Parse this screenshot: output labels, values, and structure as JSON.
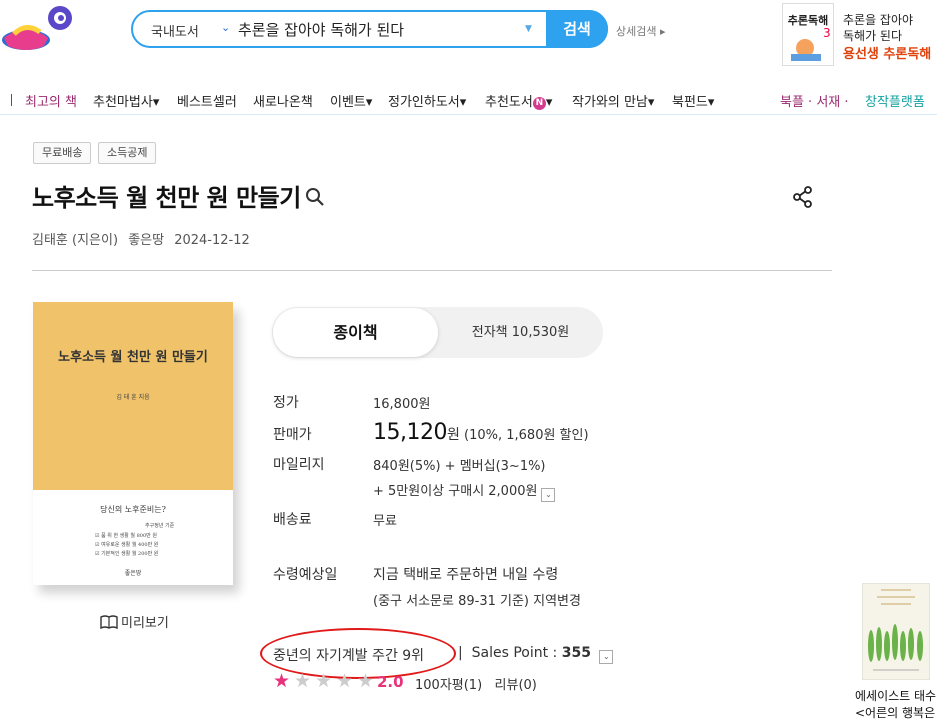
{
  "header": {
    "search": {
      "category": "국내도서",
      "query": "추론을 잡아야 독해가 된다",
      "button": "검색"
    },
    "advanced_search": "상세검색",
    "ad": {
      "cover_text": "추론독해",
      "line1": "추론을 잡아야",
      "line2": "독해가 된다",
      "line3": "용선생 추론독해"
    }
  },
  "nav": {
    "items": [
      "최고의 책",
      "추천마법사",
      "베스트셀러",
      "새로나온책",
      "이벤트",
      "정가인하도서",
      "추천도서",
      "작가와의 만남",
      "북펀드"
    ],
    "new_badge": "N",
    "right_links": [
      "북플 · 서재 ·",
      "창작플랫폼"
    ]
  },
  "product": {
    "tags": [
      "무료배송",
      "소득공제"
    ],
    "title": "노후소득 월 천만 원 만들기",
    "author": "김태훈 (지은이)",
    "publisher": "좋은땅",
    "date": "2024-12-12",
    "cover": {
      "title": "노후소득 월 천만 원 만들기",
      "author": "김 태 훈 지음",
      "subtitle": "당신의 노후준비는?",
      "tier_header": "추구정년 기준",
      "lines": [
        "☑ 품 위 한 생활 월 800만 원",
        "☑ 여유로운 생활 월 400만 원",
        "☑ 기본적인 생활 월 200만 원"
      ],
      "publisher": "좋은땅"
    },
    "preview": "미리보기",
    "tabs": {
      "paper": "종이책",
      "ebook": "전자책 10,530원"
    },
    "list_price_label": "정가",
    "list_price": "16,800원",
    "sale_label": "판매가",
    "sale_price": "15,120",
    "sale_unit": "원",
    "sale_detail": "(10%, 1,680원 할인)",
    "mileage_label": "마일리지",
    "mileage": "840원(5%) + 멤버십(3~1%)",
    "mileage_extra": "+ 5만원이상 구매시 2,000원",
    "shipping_label": "배송료",
    "shipping": "무료",
    "delivery_label": "수령예상일",
    "delivery_line1": "지금 택배로 주문하면 내일 수령",
    "delivery_line2": "(중구 서소문로 89-31 기준) 지역변경",
    "rank": "중년의 자기계발 주간 9위",
    "sales_point_label": "Sales Point :",
    "sales_point": "355",
    "rating": "2.0",
    "rating_stars": 1,
    "reviews": "100자평(1)   리뷰(0)"
  },
  "side": {
    "line1": "에세이스트 태수",
    "line2": "<어른의 행복은"
  },
  "colors": {
    "accent_blue": "#2ea2ee",
    "nav_highlight": "#9b2a6f",
    "rating_pink": "#e8337b",
    "cover_yellow": "#f0c36b",
    "annotation_red": "#e01919"
  }
}
